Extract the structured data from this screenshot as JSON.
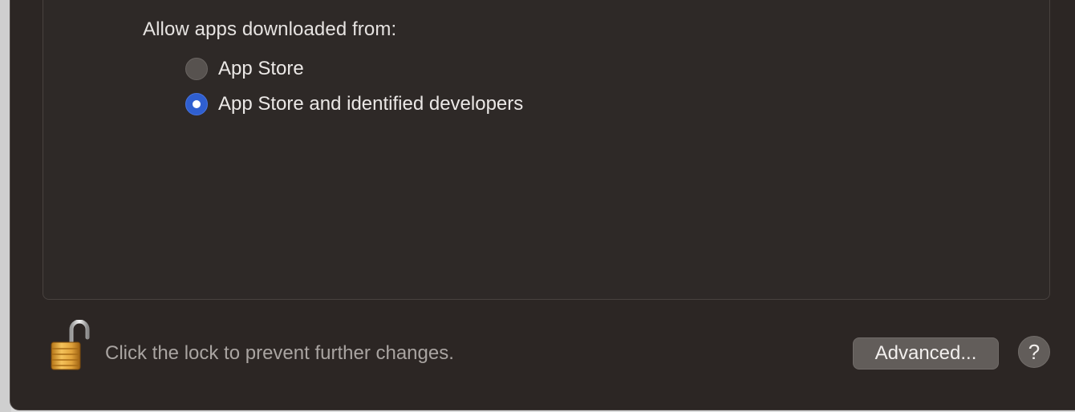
{
  "security": {
    "allow_label": "Allow apps downloaded from:",
    "options": [
      {
        "label": "App Store",
        "selected": false
      },
      {
        "label": "App Store and identified developers",
        "selected": true
      }
    ]
  },
  "footer": {
    "lock_icon": "unlocked-padlock-icon",
    "lock_text": "Click the lock to prevent further changes.",
    "advanced_label": "Advanced...",
    "help_label": "?"
  },
  "colors": {
    "window_bg": "#2c2624",
    "accent": "#2f5fd0",
    "button_bg": "#625d5a",
    "lock_gold": "#e0a23a"
  }
}
